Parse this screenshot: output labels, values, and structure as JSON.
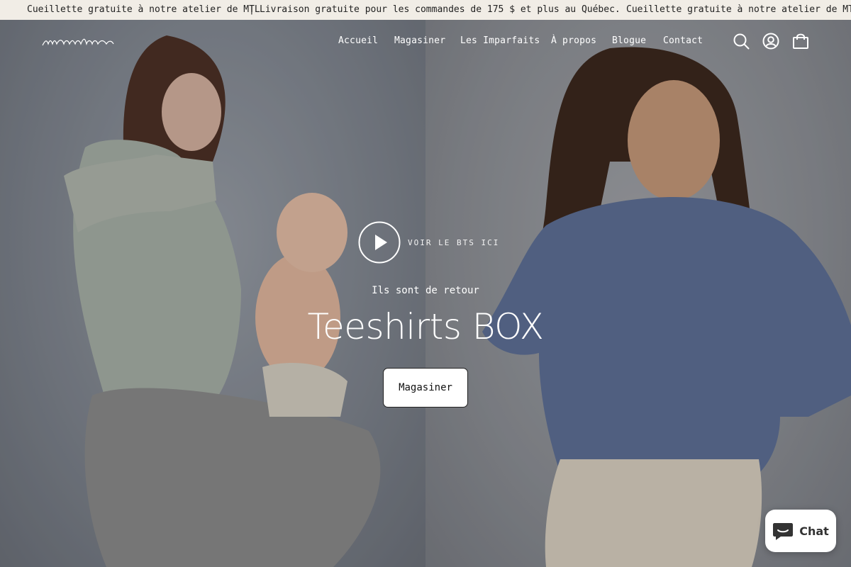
{
  "announcement": {
    "message_1": "Cueillette gratuite à notre atelier de MTL",
    "separator": "|",
    "message_2": "Livraison gratuite pour les commandes de 175 $ et plus au Québec.",
    "message_3": "Cueillette gratuite à notre atelier de MTL"
  },
  "header": {
    "nav": [
      "Accueil",
      "Magasiner",
      "Les Imparfaits",
      "À propos",
      "Blogue",
      "Contact"
    ],
    "icons": [
      "search-icon",
      "account-icon",
      "cart-icon"
    ]
  },
  "hero": {
    "video_label": "VOIR LE BTS ICI",
    "subtitle": "Ils sont de retour",
    "title": "Teeshirts BOX",
    "cta_label": "Magasiner"
  },
  "chat": {
    "label": "Chat"
  },
  "colors": {
    "announcement_bg": "#f1ede6",
    "text_light": "#ffffff",
    "chat_bg": "#ffffff"
  }
}
